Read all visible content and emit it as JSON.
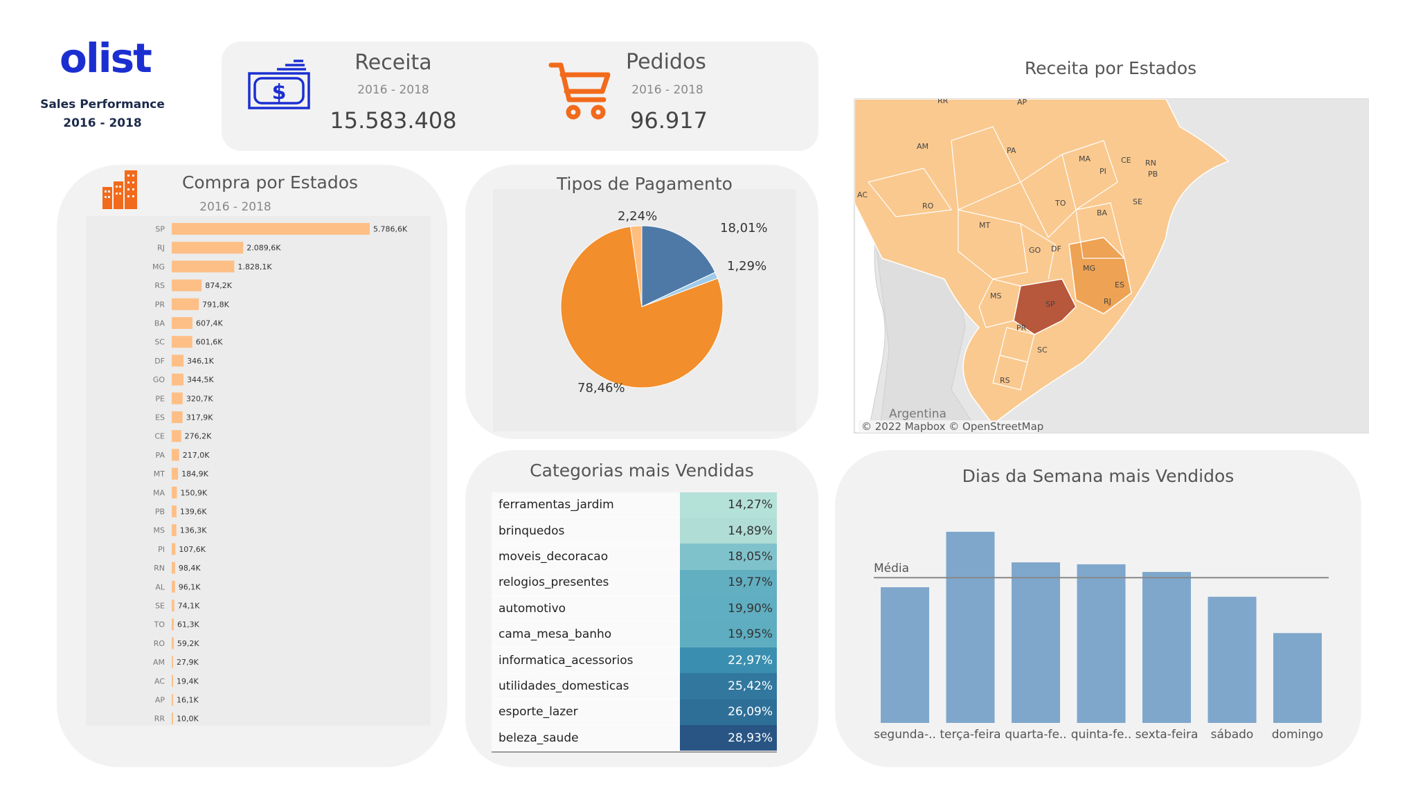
{
  "logo": {
    "name": "olist",
    "subtitle": "Sales Performance",
    "period": "2016 - 2018"
  },
  "kpis": {
    "revenue": {
      "title": "Receita",
      "period": "2016 - 2018",
      "value": "15.583.408",
      "icon": "money-icon",
      "color": "#1b2fd1"
    },
    "orders": {
      "title": "Pedidos",
      "period": "2016 - 2018",
      "value": "96.917",
      "icon": "cart-icon",
      "color": "#f26a1b"
    }
  },
  "states_chart": {
    "title": "Compra por Estados",
    "period": "2016 - 2018",
    "icon": "building-icon",
    "bar_color": "#fdbf86"
  },
  "payment_chart": {
    "title": "Tipos de Pagamento"
  },
  "categories": {
    "title": "Categorias mais Vendidas",
    "rows": [
      {
        "name": "ferramentas_jardim",
        "value": "14,27%",
        "color": "#b5e2d8",
        "text_color": "#333"
      },
      {
        "name": "brinquedos",
        "value": "14,89%",
        "color": "#b0ddd6",
        "text_color": "#333"
      },
      {
        "name": "moveis_decoracao",
        "value": "18,05%",
        "color": "#80c2cb",
        "text_color": "#333"
      },
      {
        "name": "relogios_presentes",
        "value": "19,77%",
        "color": "#62afc2",
        "text_color": "#333"
      },
      {
        "name": "automotivo",
        "value": "19,90%",
        "color": "#60aec1",
        "text_color": "#333"
      },
      {
        "name": "cama_mesa_banho",
        "value": "19,95%",
        "color": "#5eadc1",
        "text_color": "#333"
      },
      {
        "name": "informatica_acessorios",
        "value": "22,97%",
        "color": "#3a8fb0",
        "text_color": "#fff"
      },
      {
        "name": "utilidades_domesticas",
        "value": "25,42%",
        "color": "#31779e",
        "text_color": "#fff"
      },
      {
        "name": "esporte_lazer",
        "value": "26,09%",
        "color": "#2e6f98",
        "text_color": "#fff"
      },
      {
        "name": "beleza_saude",
        "value": "28,93%",
        "color": "#285584",
        "text_color": "#fff"
      }
    ]
  },
  "map": {
    "title": "Receita por Estados",
    "attribution": "© 2022 Mapbox © OpenStreetMap",
    "country_label": "Argentina",
    "state_labels": [
      "RR",
      "AP",
      "AM",
      "PA",
      "MA",
      "CE",
      "RN",
      "PB",
      "PI",
      "AC",
      "RO",
      "TO",
      "BA",
      "SE",
      "MT",
      "GO",
      "DF",
      "MG",
      "ES",
      "MS",
      "SP",
      "RJ",
      "PR",
      "SC",
      "RS"
    ]
  },
  "days_chart": {
    "title": "Dias da Semana mais Vendidos",
    "avg_label": "Média"
  },
  "chart_data": [
    {
      "type": "bar",
      "orientation": "horizontal",
      "title": "Compra por Estados",
      "categories": [
        "SP",
        "RJ",
        "MG",
        "RS",
        "PR",
        "BA",
        "SC",
        "DF",
        "GO",
        "PE",
        "ES",
        "CE",
        "PA",
        "MT",
        "MA",
        "PB",
        "MS",
        "PI",
        "RN",
        "AL",
        "SE",
        "TO",
        "RO",
        "AM",
        "AC",
        "AP",
        "RR"
      ],
      "values": [
        5786.6,
        2089.6,
        1828.1,
        874.2,
        791.8,
        607.4,
        601.6,
        346.1,
        344.5,
        320.7,
        317.9,
        276.2,
        217.0,
        184.9,
        150.9,
        139.6,
        136.3,
        107.6,
        98.4,
        96.1,
        74.1,
        61.3,
        59.2,
        27.9,
        19.4,
        16.1,
        10.0
      ],
      "labels": [
        "5.786,6K",
        "2.089,6K",
        "1.828,1K",
        "874,2K",
        "791,8K",
        "607,4K",
        "601,6K",
        "346,1K",
        "344,5K",
        "320,7K",
        "317,9K",
        "276,2K",
        "217,0K",
        "184,9K",
        "150,9K",
        "139,6K",
        "136,3K",
        "107,6K",
        "98,4K",
        "96,1K",
        "74,1K",
        "61,3K",
        "59,2K",
        "27,9K",
        "19,4K",
        "16,1K",
        "10,0K"
      ]
    },
    {
      "type": "pie",
      "title": "Tipos de Pagamento",
      "values": [
        18.01,
        1.29,
        78.46,
        2.24
      ],
      "labels": [
        "18,01%",
        "1,29%",
        "78,46%",
        "2,24%"
      ],
      "colors": [
        "#4e79a7",
        "#a0cbe8",
        "#f28e2b",
        "#ffbe7d"
      ]
    },
    {
      "type": "bar",
      "title": "Dias da Semana mais Vendidos",
      "categories": [
        "segunda-..",
        "terça-feira",
        "quarta-fe..",
        "quinta-fe..",
        "sexta-feira",
        "sábado",
        "domingo"
      ],
      "values": [
        0.71,
        1.0,
        0.84,
        0.83,
        0.79,
        0.66,
        0.47
      ],
      "average": 0.76,
      "color": "#7fa7cc"
    }
  ]
}
